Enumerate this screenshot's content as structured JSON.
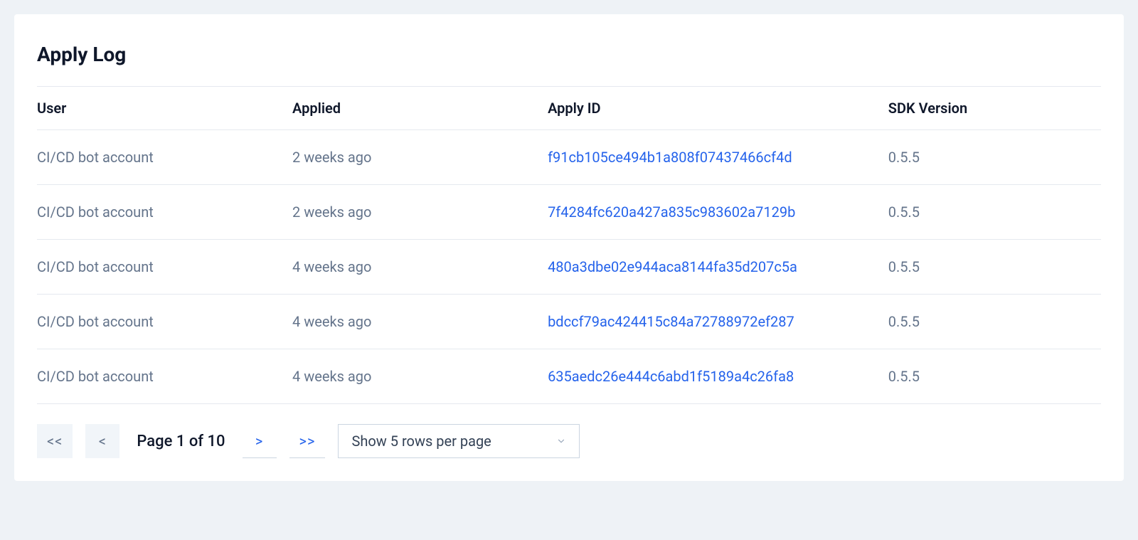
{
  "title": "Apply Log",
  "columns": {
    "user": "User",
    "applied": "Applied",
    "apply_id": "Apply ID",
    "sdk_version": "SDK Version"
  },
  "rows": [
    {
      "user": "CI/CD bot account",
      "applied": "2 weeks ago",
      "apply_id": "f91cb105ce494b1a808f07437466cf4d",
      "sdk_version": "0.5.5"
    },
    {
      "user": "CI/CD bot account",
      "applied": "2 weeks ago",
      "apply_id": "7f4284fc620a427a835c983602a7129b",
      "sdk_version": "0.5.5"
    },
    {
      "user": "CI/CD bot account",
      "applied": "4 weeks ago",
      "apply_id": "480a3dbe02e944aca8144fa35d207c5a",
      "sdk_version": "0.5.5"
    },
    {
      "user": "CI/CD bot account",
      "applied": "4 weeks ago",
      "apply_id": "bdccf79ac424415c84a72788972ef287",
      "sdk_version": "0.5.5"
    },
    {
      "user": "CI/CD bot account",
      "applied": "4 weeks ago",
      "apply_id": "635aedc26e444c6abd1f5189a4c26fa8",
      "sdk_version": "0.5.5"
    }
  ],
  "pagination": {
    "first_label": "<<",
    "prev_label": "<",
    "next_label": ">",
    "last_label": ">>",
    "status": "Page 1 of 10",
    "rows_per_page_label": "Show 5 rows per page"
  }
}
